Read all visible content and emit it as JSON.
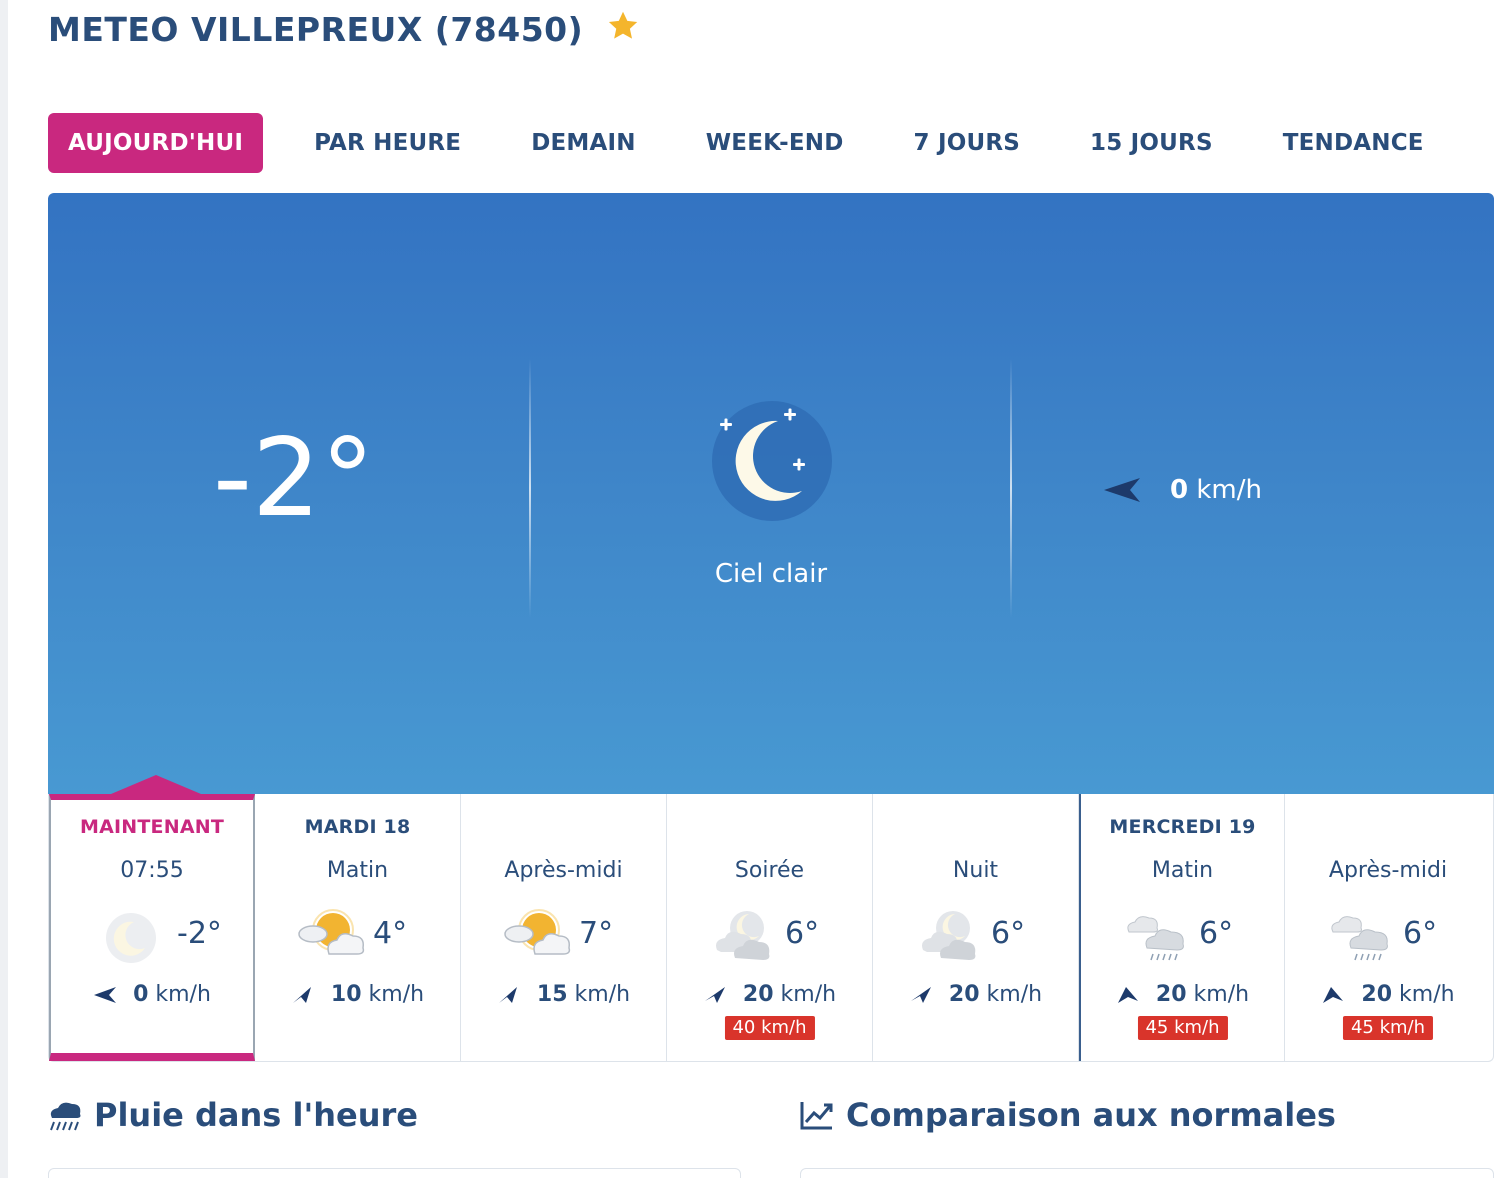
{
  "page": {
    "title": "METEO VILLEPREUX (78450)",
    "favorite_icon": "star-icon",
    "accent_color": "#c9287f",
    "brand_color": "#2a4d7a"
  },
  "tabs": [
    {
      "label": "AUJOURD'HUI",
      "active": true
    },
    {
      "label": "PAR HEURE",
      "active": false
    },
    {
      "label": "DEMAIN",
      "active": false
    },
    {
      "label": "WEEK-END",
      "active": false
    },
    {
      "label": "7 JOURS",
      "active": false
    },
    {
      "label": "15 JOURS",
      "active": false
    },
    {
      "label": "TENDANCE",
      "active": false
    }
  ],
  "current": {
    "temperature": "-2°",
    "condition": "Ciel clair",
    "icon": "clear-night-moon-icon",
    "wind_speed": "0",
    "wind_unit": "km/h"
  },
  "forecast": [
    {
      "day": "MAINTENANT",
      "period": "07:55",
      "icon": "clear-night-moon-icon",
      "temp": "-2°",
      "wind": "0",
      "unit": "km/h",
      "gust": ""
    },
    {
      "day": "MARDI 18",
      "period": "Matin",
      "icon": "partly-sunny-icon",
      "temp": "4°",
      "wind": "10",
      "unit": "km/h",
      "gust": ""
    },
    {
      "day": "",
      "period": "Après-midi",
      "icon": "partly-sunny-icon",
      "temp": "7°",
      "wind": "15",
      "unit": "km/h",
      "gust": ""
    },
    {
      "day": "",
      "period": "Soirée",
      "icon": "cloudy-night-icon",
      "temp": "6°",
      "wind": "20",
      "unit": "km/h",
      "gust": "40 km/h"
    },
    {
      "day": "",
      "period": "Nuit",
      "icon": "cloudy-night-icon",
      "temp": "6°",
      "wind": "20",
      "unit": "km/h",
      "gust": ""
    },
    {
      "day": "MERCREDI 19",
      "period": "Matin",
      "icon": "rain-clouds-icon",
      "temp": "6°",
      "wind": "20",
      "unit": "km/h",
      "gust": "45 km/h"
    },
    {
      "day": "",
      "period": "Après-midi",
      "icon": "rain-clouds-icon",
      "temp": "6°",
      "wind": "20",
      "unit": "km/h",
      "gust": "45 km/h"
    }
  ],
  "sections": {
    "rain_title": "Pluie dans l'heure",
    "rain_icon": "rain-cloud-icon",
    "normals_title": "Comparaison aux normales",
    "normals_icon": "trend-chart-icon"
  }
}
